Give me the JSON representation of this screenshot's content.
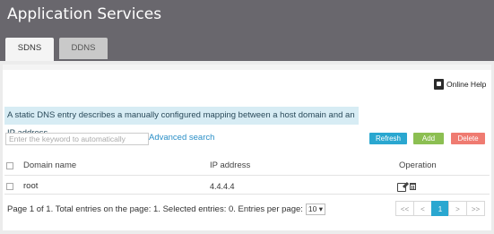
{
  "app": {
    "title": "Application Services"
  },
  "tabs": [
    {
      "label": "SDNS",
      "active": true
    },
    {
      "label": "DDNS",
      "active": false
    }
  ],
  "help": {
    "label": "Online Help",
    "icon": "help-book-icon"
  },
  "info": {
    "text": "A static DNS entry describes a manually configured mapping between a host domain and an IP address."
  },
  "search": {
    "placeholder": "Enter the keyword to automatically",
    "advanced_label": "Advanced search"
  },
  "buttons": {
    "refresh": "Refresh",
    "add": "Add",
    "delete": "Delete"
  },
  "colors": {
    "header": "#69676d",
    "accent": "#2aa7d0",
    "add": "#8cbf52",
    "delete": "#ef7b71",
    "info_bg": "#d7ecf4"
  },
  "table": {
    "columns": [
      "Domain name",
      "IP address",
      "Operation"
    ],
    "rows": [
      {
        "domain": "root",
        "ip": "4.4.4.4"
      }
    ]
  },
  "footer": {
    "summary": "Page 1 of 1. Total entries on the page: 1. Selected entries: 0. Entries per page:",
    "per_page": "10 ▾"
  },
  "pager": {
    "first": "<<",
    "prev": "<",
    "current": "1",
    "next": ">",
    "last": ">>"
  }
}
